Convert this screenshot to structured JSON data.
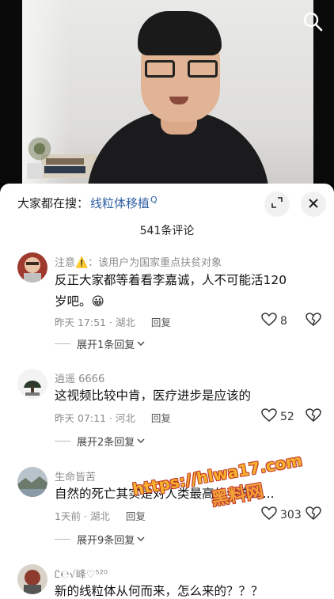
{
  "search_bar": {
    "prefix": "大家都在搜：",
    "query": "线粒体移植",
    "query_icon": "Q"
  },
  "comments_header": {
    "count_label": "541条评论"
  },
  "comments": [
    {
      "author": "注意⚠️：该用户为国家重点扶贫对象",
      "text": "反正大家都等着看李嘉诚，人不可能活120岁吧。😀",
      "time": "昨天 17:51 · 湖北",
      "reply_label": "回复",
      "likes": "8",
      "expand_label": "展开1条回复"
    },
    {
      "author": "逍遥 6666",
      "text": "这视频比较中肯，医疗进步是应该的",
      "time": "昨天 07:11 · 河北",
      "reply_label": "回复",
      "likes": "52",
      "expand_label": "展开2条回复"
    },
    {
      "author": "生命皆苦",
      "text": "自然的死亡其实是对人类最高的奖赏......",
      "time": "1天前 · 湖北",
      "reply_label": "回复",
      "likes": "303",
      "expand_label": "展开9条回复"
    },
    {
      "author": "Ꮭ℮√峰♡⁵²⁰",
      "text": "新的线粒体从何而来，怎么来的？？？"
    }
  ],
  "watermark": {
    "url": "https://hlwa17.com",
    "name": "黑料网"
  },
  "icons": {
    "search": "search-icon",
    "expand": "expand-icon",
    "close": "close-icon",
    "like": "heart-icon",
    "dislike": "broken-heart-icon"
  }
}
